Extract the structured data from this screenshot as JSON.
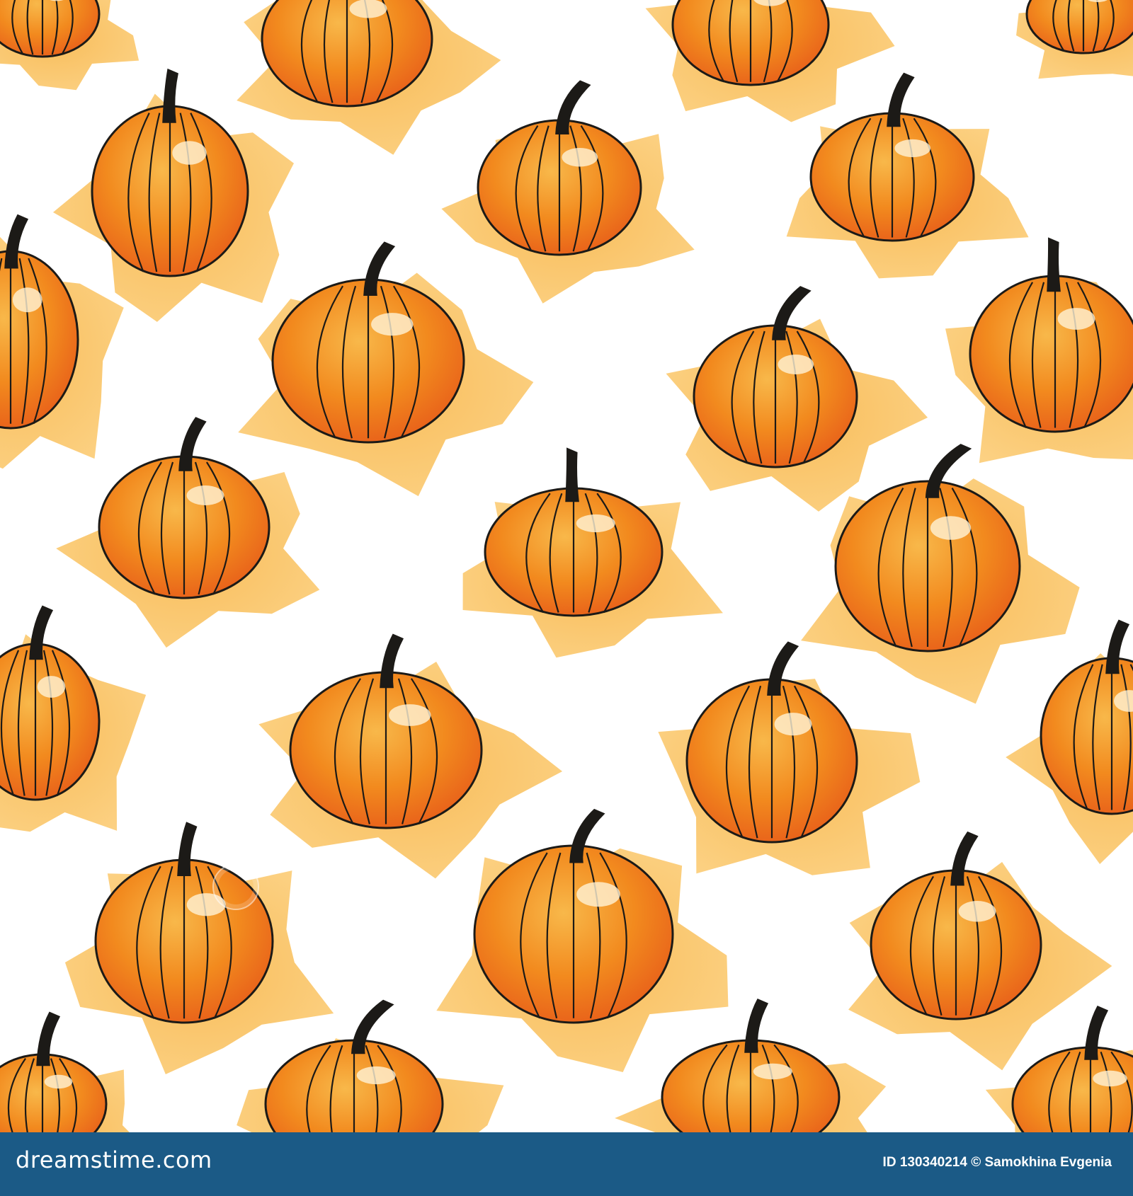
{
  "image": {
    "subject": "watercolor pumpkin pattern",
    "palette": {
      "background": "#ffffff",
      "splash": "#f5a623",
      "splash_light": "#fbc25a",
      "pumpkin_main": "#f28a1e",
      "pumpkin_deep": "#e8601a",
      "pumpkin_light": "#f8b84a",
      "highlight": "#fff3d6",
      "ink": "#1c1a17"
    }
  },
  "footer": {
    "brand": "dreamstime.com",
    "credit": "ID 130340214 © Samokhina Evgenia",
    "background": "#1b5a86",
    "text_color": "#ffffff"
  }
}
